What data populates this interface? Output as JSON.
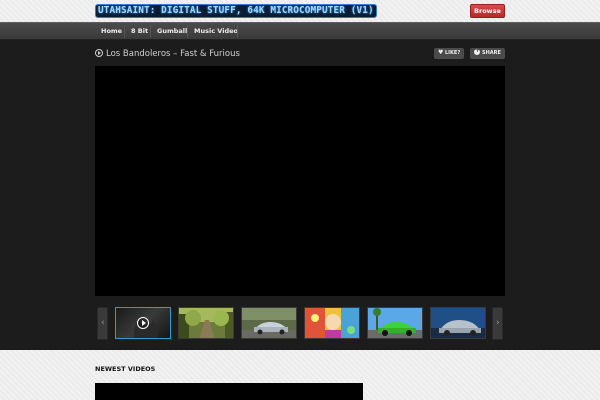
{
  "site": {
    "logo_text": "UTAHSAINT: DIGITAL STUFF, 64K MICROCOMPUTER (V1)",
    "browse_label": "Browse"
  },
  "nav": {
    "items": [
      {
        "label": "Home"
      },
      {
        "label": "8 Bit"
      },
      {
        "label": "Gumball"
      },
      {
        "label": "Music Video"
      }
    ]
  },
  "video": {
    "title": "Los Bandoleros – Fast & Furious",
    "like_label": "LIKE?",
    "share_label": "SHARE",
    "icons": {
      "title": "play-circle-icon",
      "like": "heart-icon",
      "share": "share-icon"
    }
  },
  "carousel": {
    "prev_icon": "chevron-left-icon",
    "next_icon": "chevron-right-icon",
    "prev_glyph": "‹",
    "next_glyph": "›",
    "thumbnails": [
      {
        "subject": "dark figure",
        "active": true
      },
      {
        "subject": "forest road"
      },
      {
        "subject": "silver sports car"
      },
      {
        "subject": "colorful cartoon scene"
      },
      {
        "subject": "green sports car"
      },
      {
        "subject": "silver porsche"
      }
    ]
  },
  "newest": {
    "heading": "NEWEST VIDEOS"
  },
  "colors": {
    "accent_blue": "#2f9bd6",
    "browse_red": "#c0392b",
    "dark_bg": "#1c1c1c"
  }
}
